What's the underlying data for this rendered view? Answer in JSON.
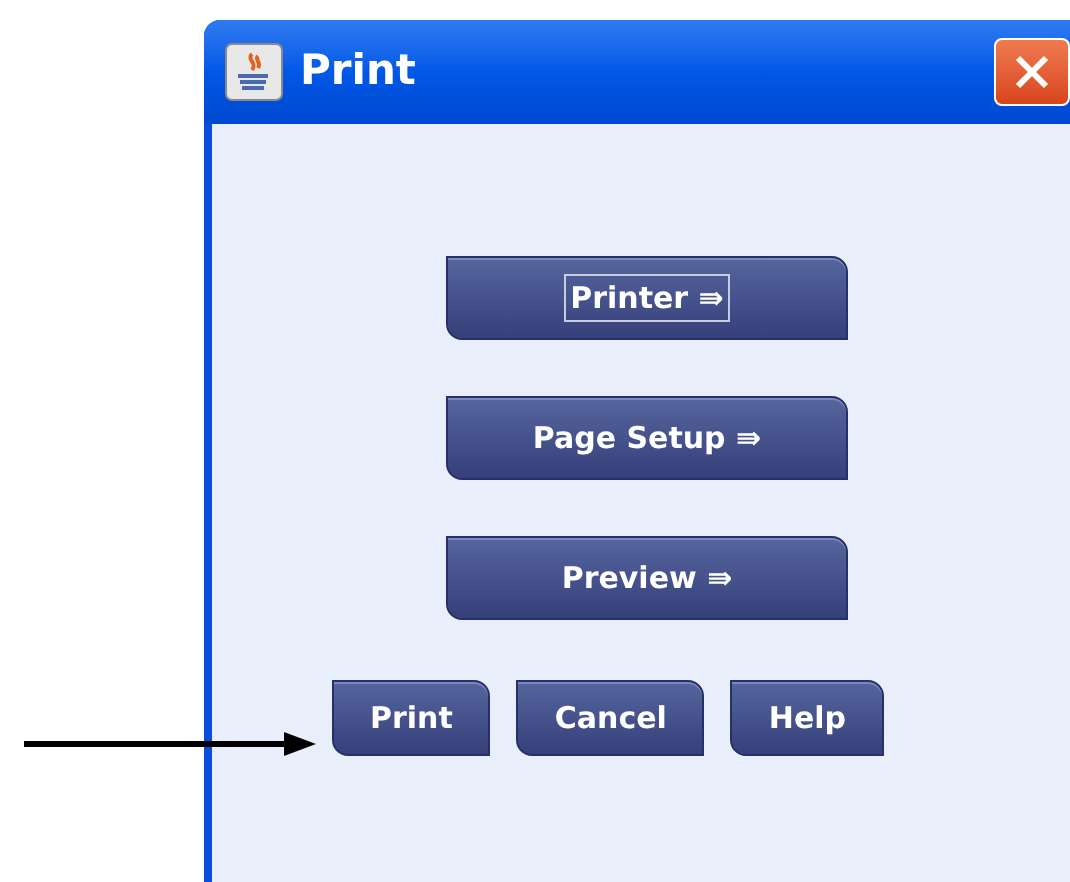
{
  "window": {
    "title": "Print"
  },
  "nav_buttons": [
    {
      "label": "Printer ⇛",
      "focused": true
    },
    {
      "label": "Page Setup ⇛",
      "focused": false
    },
    {
      "label": "Preview ⇛",
      "focused": false
    }
  ],
  "action_buttons": [
    "Print",
    "Cancel",
    "Help"
  ]
}
